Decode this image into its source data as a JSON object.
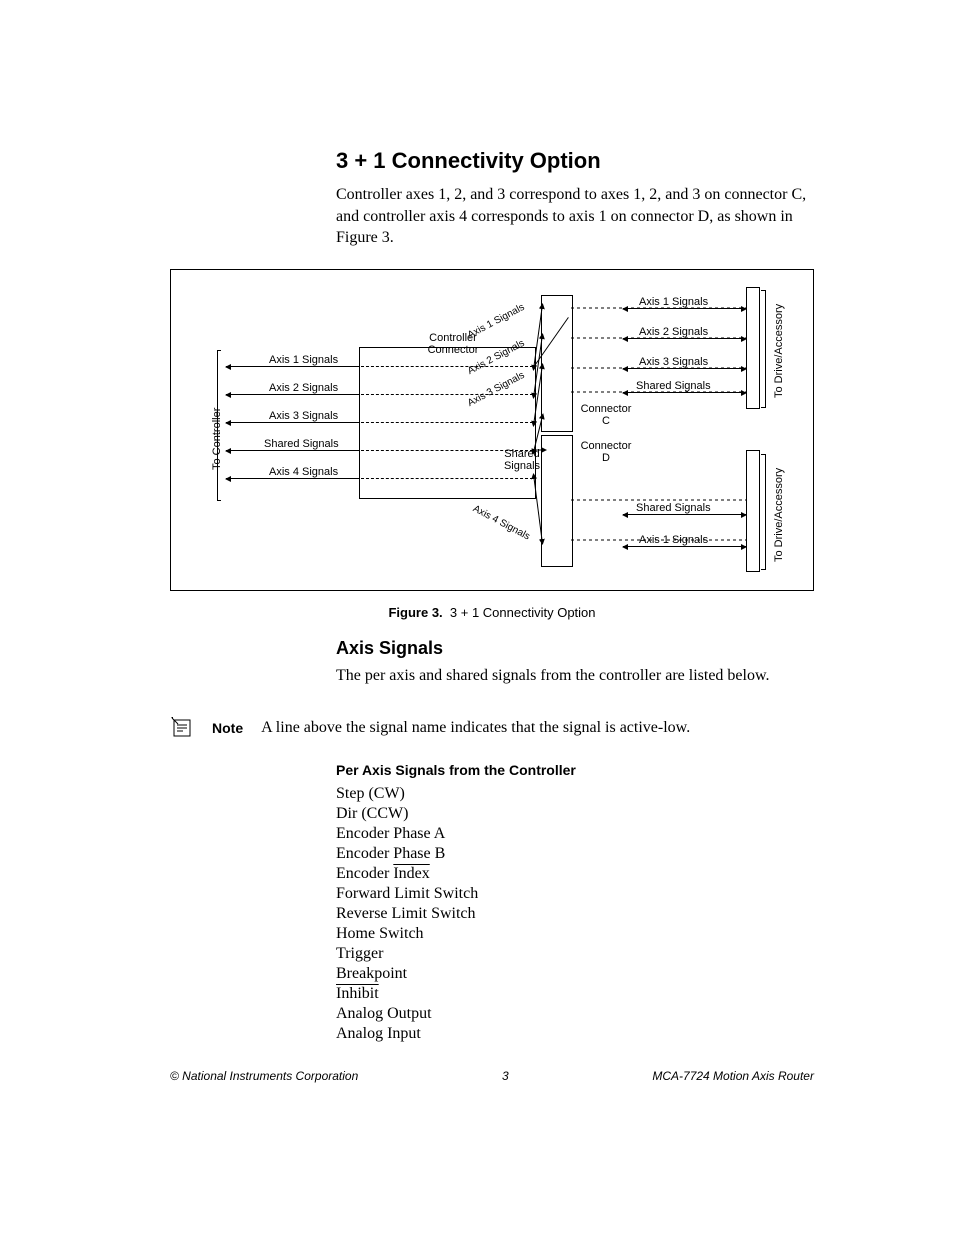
{
  "section": {
    "title": "3 + 1 Connectivity Option",
    "paragraph": "Controller axes 1, 2, and 3 correspond to axes 1, 2, and 3 on connector C, and controller axis 4 corresponds to axis 1 on connector D, as shown in Figure 3."
  },
  "figure": {
    "caption_label": "Figure 3.",
    "caption_text": "3 + 1 Connectivity Option",
    "left_block_label": "Controller Connector",
    "left_signals": [
      "Axis 1 Signals",
      "Axis 2 Signals",
      "Axis 3 Signals",
      "Shared Signals",
      "Axis 4 Signals"
    ],
    "left_axis_label": "To Controller",
    "mid_top_label": "Connector C",
    "mid_bot_label": "Connector D",
    "shared_mid_label": "Shared Signals",
    "diag_labels": [
      "Axis 1 Signals",
      "Axis 2 Signals",
      "Axis 3 Signals",
      "Axis 4 Signals"
    ],
    "right_top_signals": [
      "Axis 1 Signals",
      "Axis 2 Signals",
      "Axis 3 Signals",
      "Shared Signals"
    ],
    "right_bot_signals": [
      "Shared Signals",
      "Axis 1 Signals"
    ],
    "right_axis_label": "To Drive/Accessory"
  },
  "subsection": {
    "title": "Axis Signals",
    "paragraph": "The per axis and shared signals from the controller are listed below."
  },
  "note": {
    "label": "Note",
    "text": "A line above the signal name indicates that the signal is active-low."
  },
  "signals": {
    "title": "Per Axis Signals from the Controller",
    "items": [
      {
        "text": "Step (CW)"
      },
      {
        "text": "Dir (CCW)"
      },
      {
        "text": "Encoder Phase A"
      },
      {
        "text": "Encoder Phase B"
      },
      {
        "prefix": "Encoder ",
        "overline": "Index"
      },
      {
        "text": "Forward Limit Switch"
      },
      {
        "text": "Reverse Limit Switch"
      },
      {
        "text": "Home Switch"
      },
      {
        "text": "Trigger"
      },
      {
        "text": "Breakpoint"
      },
      {
        "overline": "Inhibit"
      },
      {
        "text": "Analog Output"
      },
      {
        "text": "Analog Input"
      }
    ]
  },
  "footer": {
    "left": "© National Instruments Corporation",
    "center": "3",
    "right": "MCA-7724 Motion Axis Router"
  }
}
